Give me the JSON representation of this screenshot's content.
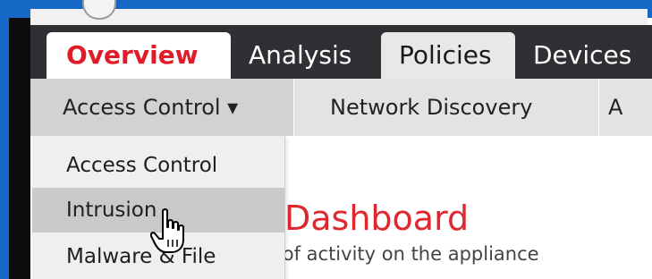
{
  "main_nav": {
    "tabs": [
      {
        "label": "Overview",
        "state": "active"
      },
      {
        "label": "Analysis",
        "state": "normal"
      },
      {
        "label": "Policies",
        "state": "selected"
      },
      {
        "label": "Devices",
        "state": "normal"
      }
    ]
  },
  "sub_nav": {
    "items": [
      {
        "label": "Access Control ▾",
        "state": "current"
      },
      {
        "label": "Network Discovery",
        "state": "normal"
      },
      {
        "label": "A",
        "state": "normal"
      }
    ]
  },
  "dropdown": {
    "items": [
      {
        "label": "Access Control",
        "state": "normal"
      },
      {
        "label": "Intrusion",
        "state": "hover"
      },
      {
        "label": "Malware & File",
        "state": "normal"
      }
    ]
  },
  "page": {
    "title": "Dashboard",
    "subtitle": "ry of activity on the appliance"
  },
  "colors": {
    "accent_red": "#e21b29",
    "window_border_blue": "#1668c6",
    "nav_bg": "#2f3033",
    "subnav_bg": "#e3e3e3",
    "dropdown_bg": "#efefef",
    "dropdown_hover": "#c9c9c9"
  },
  "icons": {
    "cursor": "hand-pointer-icon"
  }
}
